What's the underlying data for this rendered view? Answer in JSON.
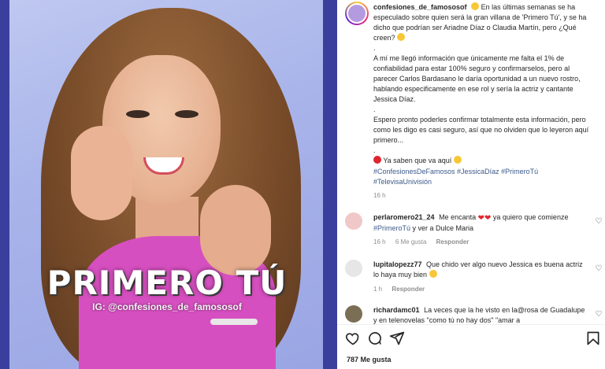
{
  "post": {
    "image": {
      "title_overlay": "PRIMERO TÚ",
      "handle_overlay": "IG: @confesiones_de_famososof"
    },
    "author": "confesiones_de_famososof",
    "caption": {
      "p1": "En las últimas semanas se ha especulado sobre quien será la gran villana de 'Primero Tú', y se ha dicho que podrían ser Ariadne Díaz o Claudia Martín, pero ¿Qué creen?",
      "p2": "A mí me llegó información que únicamente me falta el 1% de confiabilidad para estar 100% seguro y confirmarselos, pero al parecer Carlos Bardasano le daría oportunidad a un nuevo rostro, hablando especificamente en ese rol y sería la actriz y cantante Jessica Díaz.",
      "p3": "Espero pronto poderles confirmar totalmente esta información, pero como les digo es casi seguro, así que no olviden que lo leyeron aquí primero...",
      "p4": "Ya saben que va aquí",
      "dot": "."
    },
    "hashtags": "#ConfesionesDeFamosos #JessicaDíaz #PrimeroTú #TelevisaUnivisión",
    "time": "16 h",
    "likes": "787 Me gusta"
  },
  "comments": [
    {
      "user": "perlaromero21_24",
      "text_before": "Me encanta",
      "text_after": "ya quiero que comienze",
      "tag": "#PrimeroTú",
      "text_end": "y ver a Dulce Maria",
      "time": "16 h",
      "likes": "6 Me gusta",
      "reply": "Responder",
      "avatar_color": "#f0c8c8"
    },
    {
      "user": "lupitalopezz77",
      "text": "Que chido ver algo nuevo Jessica es buena actriz lo haya muy bien",
      "time": "1 h",
      "reply": "Responder",
      "avatar_color": "#e6e6e6"
    },
    {
      "user": "richardamc01",
      "text": "La veces que la he visto en la@rosa de Guadalupe y en telenovelas \"como tú no hay dos\" \"amar a",
      "avatar_color": "#7a6f55"
    }
  ],
  "icons": {
    "like": "heart-icon",
    "comment": "comment-icon",
    "share": "send-icon",
    "save": "bookmark-icon",
    "comment_like": "heart-outline-icon"
  },
  "colors": {
    "link": "#3d5a8a",
    "muted": "#8e8e8e",
    "heart_red": "#e0242e",
    "backdrop": "#3a3f9e"
  }
}
